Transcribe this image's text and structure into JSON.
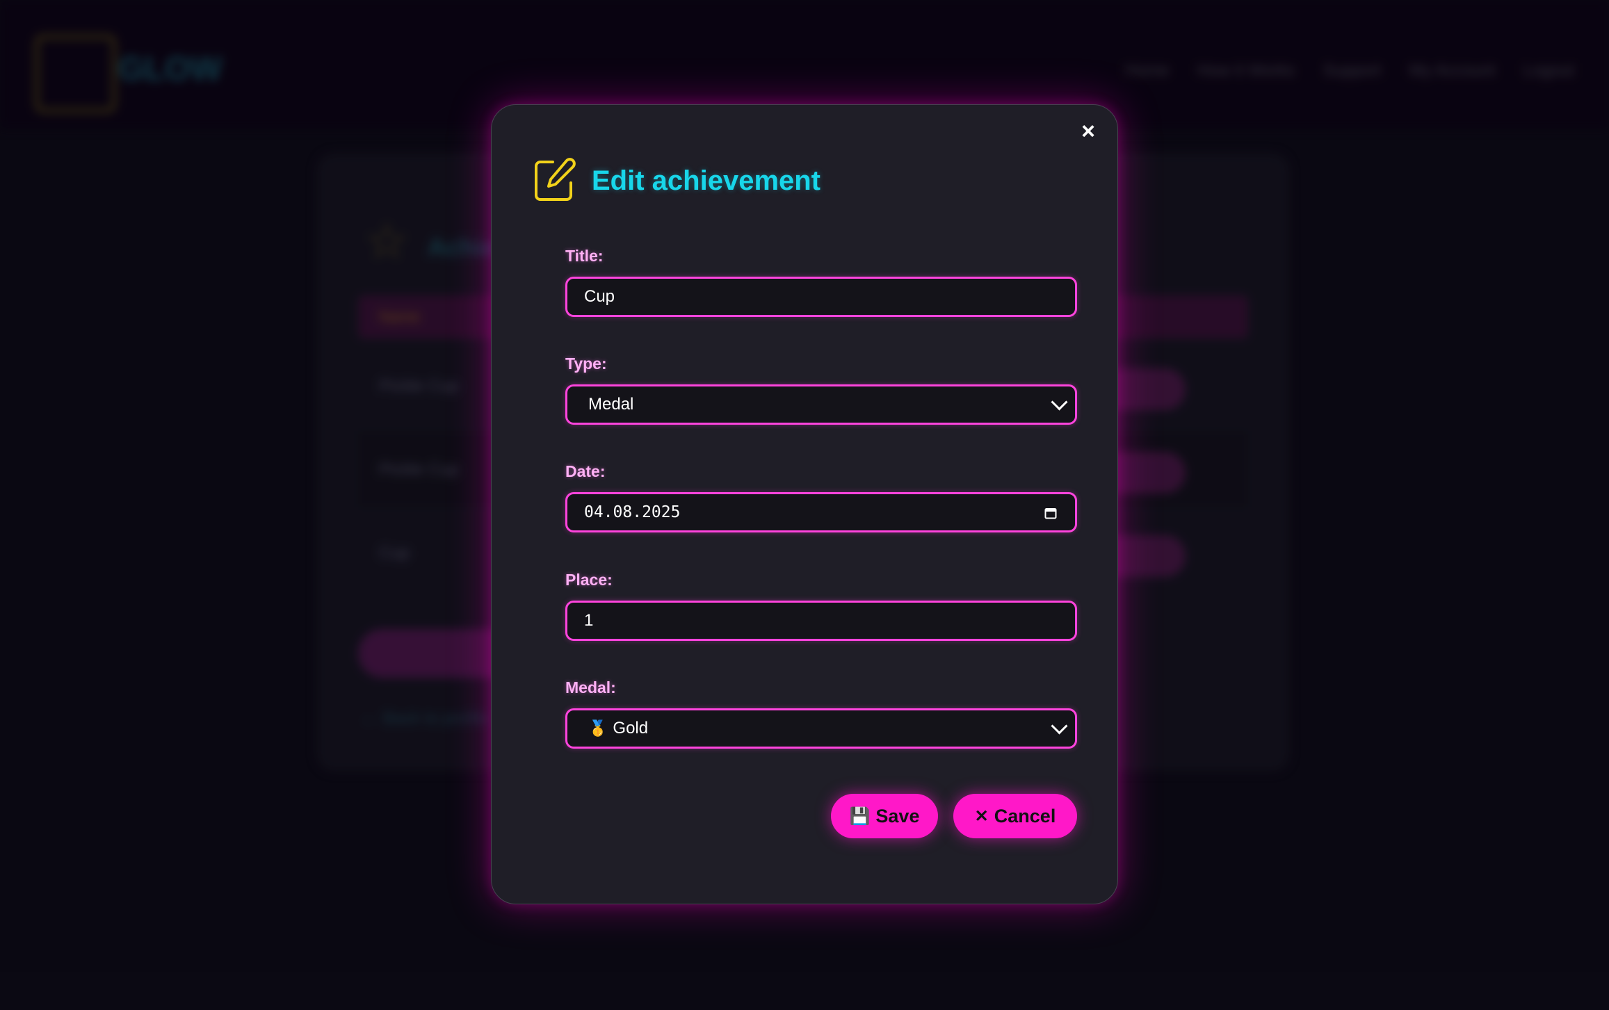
{
  "background": {
    "brand": "GLOW",
    "nav_links": [
      "Home",
      "How it Works",
      "Support",
      "My Account",
      "Logout"
    ],
    "page_title": "Achievements",
    "table_header": "Name",
    "rows": [
      "Pickle Cup",
      "Pickle Cup",
      "Cup"
    ],
    "back_link": "← Back to profile"
  },
  "modal": {
    "title": "Edit achievement",
    "close_label": "×",
    "fields": {
      "title": {
        "label": "Title:",
        "value": "Cup"
      },
      "type": {
        "label": "Type:",
        "value": "Medal"
      },
      "date": {
        "label": "Date:",
        "value": "04.08.2025"
      },
      "place": {
        "label": "Place:",
        "value": "1"
      },
      "medal": {
        "label": "Medal:",
        "value": "Gold",
        "icon": "🥇"
      }
    },
    "buttons": {
      "save": {
        "icon": "💾",
        "label": "Save"
      },
      "cancel": {
        "icon": "✕",
        "label": "Cancel"
      }
    }
  },
  "colors": {
    "accent_pink": "#ff18c8",
    "title_cyan": "#18d6ea",
    "icon_yellow": "#f2d21a",
    "label_pink": "#ffb0f4"
  }
}
